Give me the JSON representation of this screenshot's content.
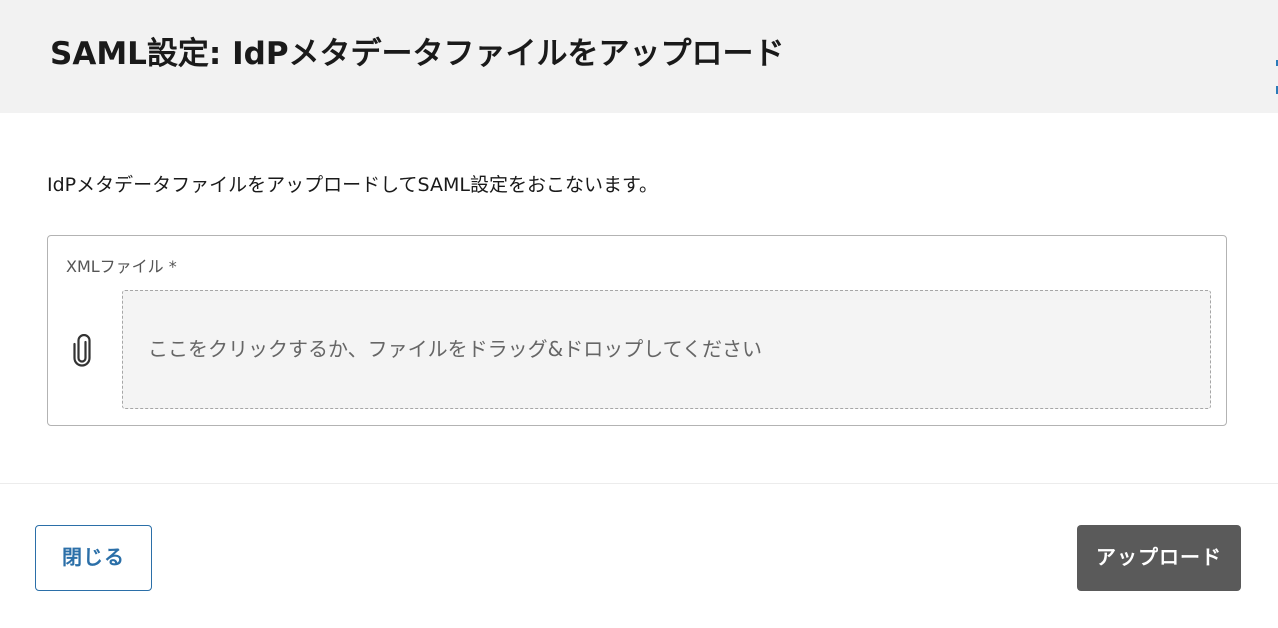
{
  "dialog": {
    "title": "SAML設定: IdPメタデータファイルをアップロード",
    "description": "IdPメタデータファイルをアップロードしてSAML設定をおこないます。"
  },
  "file_field": {
    "label": "XMLファイル *",
    "icon": "paperclip-icon",
    "drop_text": "ここをクリックするか、ファイルをドラッグ&ドロップしてください"
  },
  "footer": {
    "close_label": "閉じる",
    "upload_label": "アップロード"
  },
  "colors": {
    "header_bg": "#f2f2f2",
    "close_accent": "#2b6fa8",
    "upload_bg": "#5a5a5a",
    "drop_bg": "#f4f4f4"
  }
}
